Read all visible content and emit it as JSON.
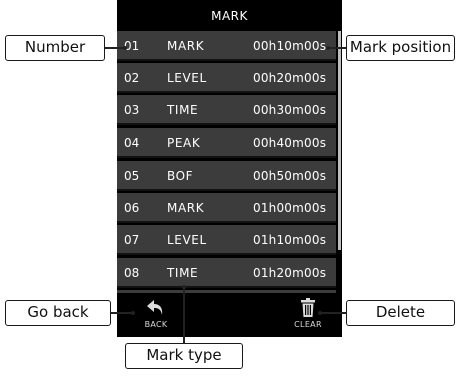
{
  "screen": {
    "title": "MARK",
    "rows": [
      {
        "number": "01",
        "type": "MARK",
        "position": "00h10m00s"
      },
      {
        "number": "02",
        "type": "LEVEL",
        "position": "00h20m00s"
      },
      {
        "number": "03",
        "type": "TIME",
        "position": "00h30m00s"
      },
      {
        "number": "04",
        "type": "PEAK",
        "position": "00h40m00s"
      },
      {
        "number": "05",
        "type": "BOF",
        "position": "00h50m00s"
      },
      {
        "number": "06",
        "type": "MARK",
        "position": "01h00m00s"
      },
      {
        "number": "07",
        "type": "LEVEL",
        "position": "01h10m00s"
      },
      {
        "number": "08",
        "type": "TIME",
        "position": "01h20m00s"
      }
    ],
    "back_label": "BACK",
    "clear_label": "CLEAR",
    "back_icon": "back-arrow-icon",
    "clear_icon": "trash-icon"
  },
  "callouts": {
    "number": "Number",
    "mark_position": "Mark position",
    "go_back": "Go back",
    "delete": "Delete",
    "mark_type": "Mark type"
  }
}
